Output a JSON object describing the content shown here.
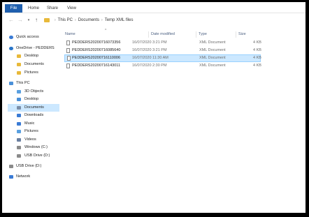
{
  "ribbon": {
    "file_tab": "File",
    "tabs": [
      "Home",
      "Share",
      "View"
    ]
  },
  "nav": {
    "back_icon": "arrow-left-icon",
    "forward_icon": "arrow-right-icon",
    "recent_icon": "chevron-down-icon",
    "up_icon": "arrow-up-icon",
    "breadcrumb": [
      "This PC",
      "Documents",
      "Temp XML files"
    ]
  },
  "sidebar": {
    "items": [
      {
        "label": "Quick access",
        "icon": "star-icon",
        "color": "#3a7bd5"
      },
      {
        "label": "OneDrive - PEDDERS",
        "icon": "cloud-icon",
        "color": "#2a76c9"
      },
      {
        "label": "Desktop",
        "icon": "folder-icon",
        "color": "#e8b93a"
      },
      {
        "label": "Documents",
        "icon": "folder-icon",
        "color": "#e8b93a"
      },
      {
        "label": "Pictures",
        "icon": "folder-icon",
        "color": "#e8b93a"
      },
      {
        "label": "This PC",
        "icon": "computer-icon",
        "color": "#4a90d9"
      },
      {
        "label": "3D Objects",
        "icon": "cube-icon",
        "color": "#5aa0e0"
      },
      {
        "label": "Desktop",
        "icon": "desktop-icon",
        "color": "#4a90d9"
      },
      {
        "label": "Documents",
        "icon": "documents-icon",
        "color": "#7a8ea8"
      },
      {
        "label": "Downloads",
        "icon": "download-icon",
        "color": "#3a7bd5"
      },
      {
        "label": "Music",
        "icon": "music-icon",
        "color": "#3a7bd5"
      },
      {
        "label": "Pictures",
        "icon": "pictures-icon",
        "color": "#5aa0e0"
      },
      {
        "label": "Videos",
        "icon": "videos-icon",
        "color": "#6a7fa0"
      },
      {
        "label": "Windows (C:)",
        "icon": "drive-icon",
        "color": "#8a8a8a"
      },
      {
        "label": "USB Drive (D:)",
        "icon": "usb-drive-icon",
        "color": "#8a8a8a"
      },
      {
        "label": "USB Drive (D:)",
        "icon": "usb-drive-icon",
        "color": "#8a8a8a"
      },
      {
        "label": "Network",
        "icon": "network-icon",
        "color": "#3a7bd5"
      }
    ],
    "selected_index": 8
  },
  "columns": {
    "name": "Name",
    "date": "Date modified",
    "type": "Type",
    "size": "Size"
  },
  "files": [
    {
      "name": "PEDDERS20200716073356",
      "date": "16/07/2020 3:21 PM",
      "type": "XML Document",
      "size": "4 KB"
    },
    {
      "name": "PEDDERS20200716085640",
      "date": "16/07/2020 3:21 PM",
      "type": "XML Document",
      "size": "4 KB"
    },
    {
      "name": "PEDDERS20200716110006",
      "date": "16/07/2020 11:30 AM",
      "type": "XML Document",
      "size": "4 KB"
    },
    {
      "name": "PEDDERS20200716143011",
      "date": "16/07/2020 2:30 PM",
      "type": "XML Document",
      "size": "4 KB"
    }
  ],
  "selected_file_index": 2,
  "colors": {
    "accent": "#1f5fae",
    "selection": "#cce8ff"
  }
}
